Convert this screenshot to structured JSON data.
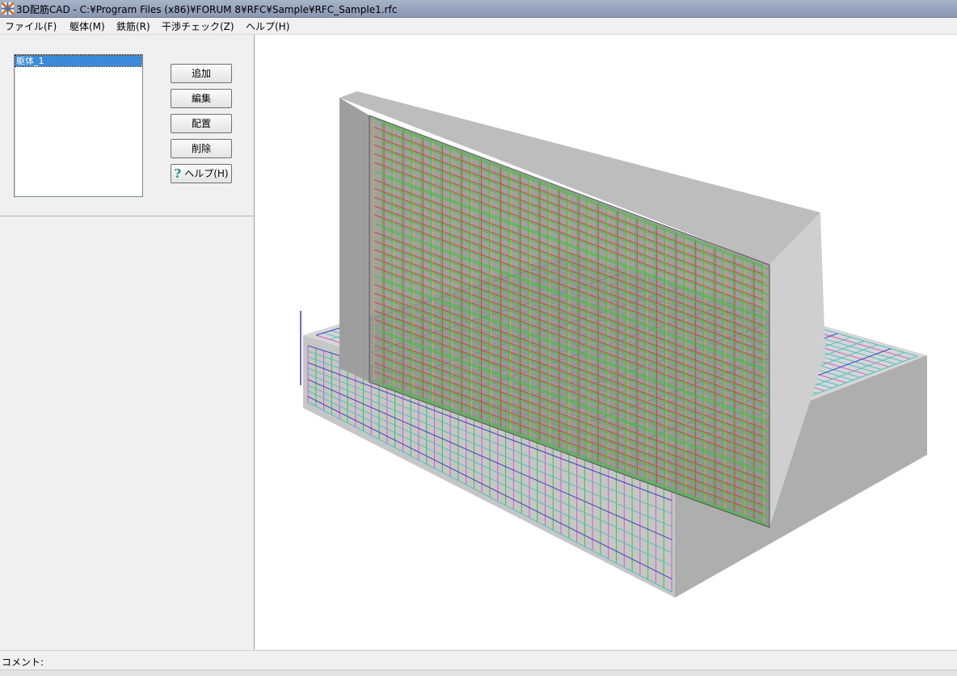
{
  "window": {
    "title": "3D配筋CAD - C:¥Program Files (x86)¥FORUM 8¥RFC¥Sample¥RFC_Sample1.rfc",
    "icon": "app-icon"
  },
  "menu": {
    "items": [
      {
        "label": "ファイル(F)"
      },
      {
        "label": "躯体(M)"
      },
      {
        "label": "鉄筋(R)"
      },
      {
        "label": "干渉チェック(Z)"
      },
      {
        "label": "ヘルプ(H)"
      }
    ]
  },
  "body_panel": {
    "list_items": [
      {
        "label": "躯体_1",
        "selected": true
      }
    ],
    "buttons": {
      "add": "追加",
      "edit": "編集",
      "place": "配置",
      "delete": "削除",
      "help": "ヘルプ(H)"
    }
  },
  "status": {
    "comment_label": "コメント:"
  },
  "colors": {
    "selection": "#3a8ad9",
    "concrete": "#c8c8c8",
    "rebar_red": "#d04040",
    "rebar_green": "#40c040",
    "rebar_blue": "#4040c8",
    "rebar_magenta": "#d060c0",
    "rebar_cyan": "#50c0c0",
    "rebar_yellow": "#d0b040"
  }
}
